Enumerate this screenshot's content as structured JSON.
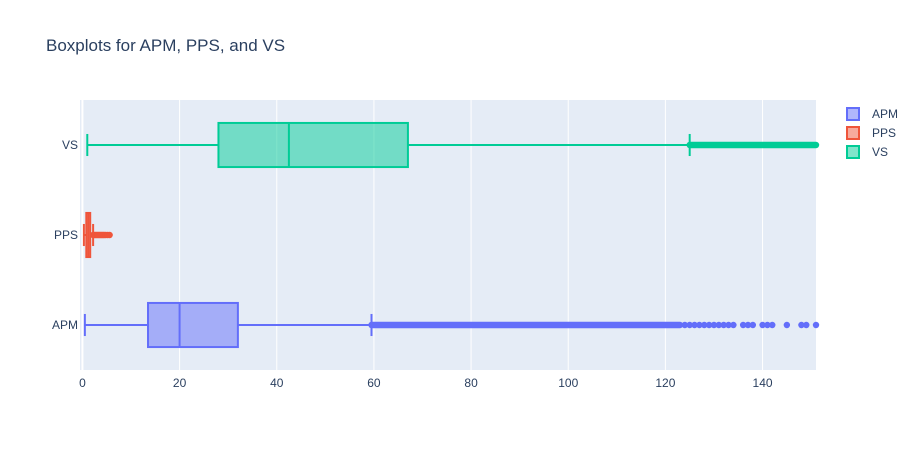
{
  "chart_data": {
    "type": "box",
    "orientation": "horizontal",
    "title": "Boxplots for APM, PPS, and VS",
    "xlabel": "",
    "ylabel": "",
    "xlim": [
      -0.5,
      151
    ],
    "xticks": [
      0,
      20,
      40,
      60,
      80,
      100,
      120,
      140
    ],
    "categories": [
      "APM",
      "PPS",
      "VS"
    ],
    "grid": true,
    "legend_position": "top-right",
    "series": [
      {
        "name": "APM",
        "color": "#636efa",
        "min": 0.5,
        "q1": 13.5,
        "median": 20,
        "q3": 32,
        "upper_fence": 59.5,
        "outliers_dense_range": [
          59.5,
          123
        ],
        "outliers_sparse": [
          124,
          125,
          126,
          127,
          128,
          129,
          130,
          131,
          132,
          133,
          134,
          136,
          137,
          138,
          140,
          141,
          142,
          145,
          148,
          149,
          151
        ]
      },
      {
        "name": "PPS",
        "color": "#ef553b",
        "min": 0.3,
        "q1": 0.8,
        "median": 1.2,
        "q3": 1.6,
        "upper_fence": 2.2,
        "outliers_dense_range": [
          2.2,
          4.5
        ],
        "outliers_sparse": [
          4.8,
          5.2,
          5.6
        ]
      },
      {
        "name": "VS",
        "color": "#00cc96",
        "min": 1,
        "q1": 28,
        "median": 42.5,
        "q3": 67,
        "upper_fence": 125,
        "outliers_dense_range": [
          125,
          151
        ],
        "outliers_sparse": []
      }
    ]
  }
}
